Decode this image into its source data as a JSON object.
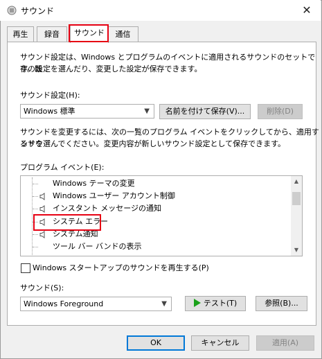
{
  "window": {
    "title": "サウンド",
    "close_glyph": "✕"
  },
  "tabs": [
    {
      "label": "再生"
    },
    {
      "label": "録音"
    },
    {
      "label": "サウンド"
    },
    {
      "label": "通信"
    }
  ],
  "description": {
    "line1": "サウンド設定は、Windows とプログラムのイベントに適用されるサウンドのセットです。既",
    "line2": "存の設定を選んだり、変更した設定が保存できます。"
  },
  "scheme": {
    "label": "サウンド設定(H):",
    "value": "Windows 標準",
    "save_as": "名前を付けて保存(V)...",
    "delete": "削除(D)"
  },
  "instructions": {
    "line1": "サウンドを変更するには、次の一覧のプログラム イベントをクリックしてから、適用するサウ",
    "line2": "ンドを選んでください。変更内容が新しいサウンド設定として保存できます。"
  },
  "events": {
    "label": "プログラム イベント(E):",
    "items": [
      {
        "label": "Windows テーマの変更",
        "has_sound": false
      },
      {
        "label": "Windows ユーザー アカウント制御",
        "has_sound": true
      },
      {
        "label": "インスタント メッセージの通知",
        "has_sound": true
      },
      {
        "label": "システム エラー",
        "has_sound": true,
        "selected": true
      },
      {
        "label": "システム通知",
        "has_sound": true
      },
      {
        "label": "ツール バー バンドの表示",
        "has_sound": false
      }
    ]
  },
  "startup": {
    "label": "Windows スタートアップのサウンドを再生する(P)",
    "checked": false
  },
  "sound": {
    "label": "サウンド(S):",
    "value": "Windows Foreground",
    "test": "テスト(T)",
    "browse": "参照(B)..."
  },
  "footer": {
    "ok": "OK",
    "cancel": "キャンセル",
    "apply": "適用(A)"
  },
  "colors": {
    "highlight": "#e60012",
    "play_icon": "#1aa11a",
    "focus_border": "#0078d7"
  },
  "icons": [
    "speaker-title-icon",
    "close-icon",
    "speaker-icon",
    "chevron-down-icon",
    "scroll-up-icon",
    "scroll-down-icon",
    "play-icon"
  ]
}
